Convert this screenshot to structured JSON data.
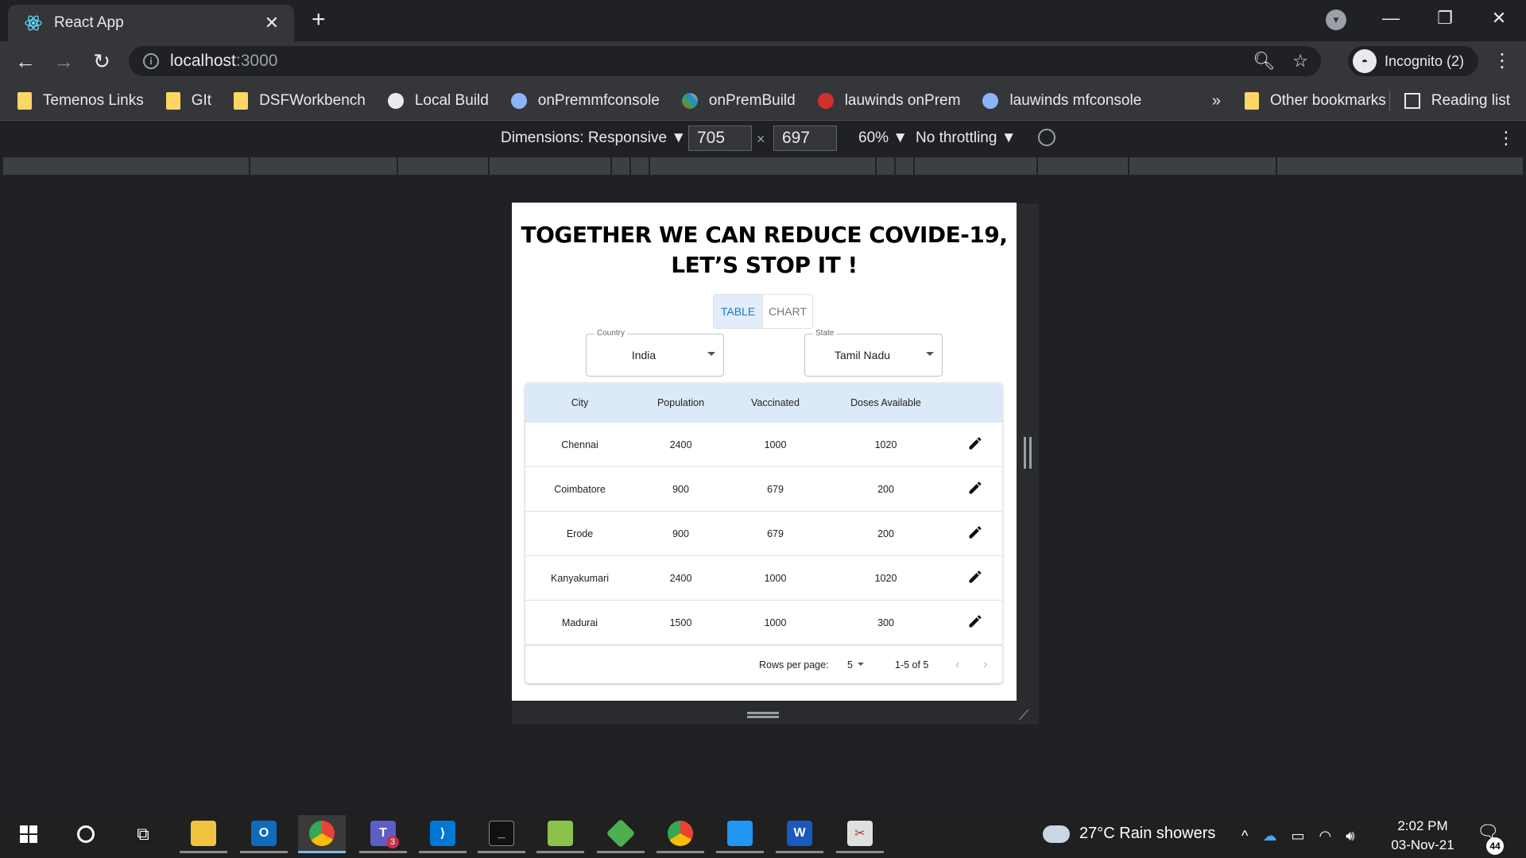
{
  "browser": {
    "tab": {
      "title": "React App",
      "close": "✕"
    },
    "new_tab": "+",
    "window": {
      "minimize": "—",
      "restore": "❐",
      "close": "✕"
    },
    "url": {
      "host": "localhost",
      "port": ":3000"
    },
    "profile": {
      "label": "Incognito (2)"
    },
    "bookmarks": [
      {
        "label": "Temenos Links",
        "icon": "folder-icon"
      },
      {
        "label": "GIt",
        "icon": "folder-icon"
      },
      {
        "label": "DSFWorkbench",
        "icon": "folder-icon"
      },
      {
        "label": "Local Build",
        "icon": "globe-icon"
      },
      {
        "label": "onPremmfconsole",
        "icon": "cube-icon"
      },
      {
        "label": "onPremBuild",
        "icon": "pinwheel-icon"
      },
      {
        "label": "lauwinds onPrem",
        "icon": "redhat-icon"
      },
      {
        "label": "lauwinds mfconsole",
        "icon": "cube-icon"
      }
    ],
    "bookmarks_more": "»",
    "other_bookmarks": "Other bookmarks",
    "reading_list": "Reading list"
  },
  "devtools": {
    "dimensions": "Dimensions: Responsive ▼",
    "width": "705",
    "times": "×",
    "height": "697",
    "zoom": "60% ▼",
    "throttling": "No throttling ▼"
  },
  "app": {
    "title": "TOGETHER WE CAN REDUCE COVIDE-19, LET’S STOP IT !",
    "tabs": [
      "TABLE",
      "CHART"
    ],
    "selected_tab": "TABLE",
    "country": {
      "label": "Country",
      "value": "India"
    },
    "state": {
      "label": "State",
      "value": "Tamil Nadu"
    },
    "table": {
      "headers": [
        "City",
        "Population",
        "Vaccinated",
        "Doses Available"
      ],
      "rows": [
        [
          "Chennai",
          "2400",
          "1000",
          "1020"
        ],
        [
          "Coimbatore",
          "900",
          "679",
          "200"
        ],
        [
          "Erode",
          "900",
          "679",
          "200"
        ],
        [
          "Kanyakumari",
          "2400",
          "1000",
          "1020"
        ],
        [
          "Madurai",
          "1500",
          "1000",
          "300"
        ]
      ]
    },
    "pagination": {
      "rows_per_page_label": "Rows per page:",
      "rows_per_page": "5",
      "range": "1-5 of 5",
      "prev": "‹",
      "next": "›"
    }
  },
  "taskbar": {
    "weather": "27°C  Rain showers",
    "time": "2:02 PM",
    "date": "03-Nov-21",
    "teams_badge": "3",
    "notifications": "44"
  },
  "colors": {
    "accent": "#1976d2",
    "header_bg": "#dce9f8",
    "chrome_dark": "#202124",
    "chrome_toolbar": "#35363a"
  }
}
